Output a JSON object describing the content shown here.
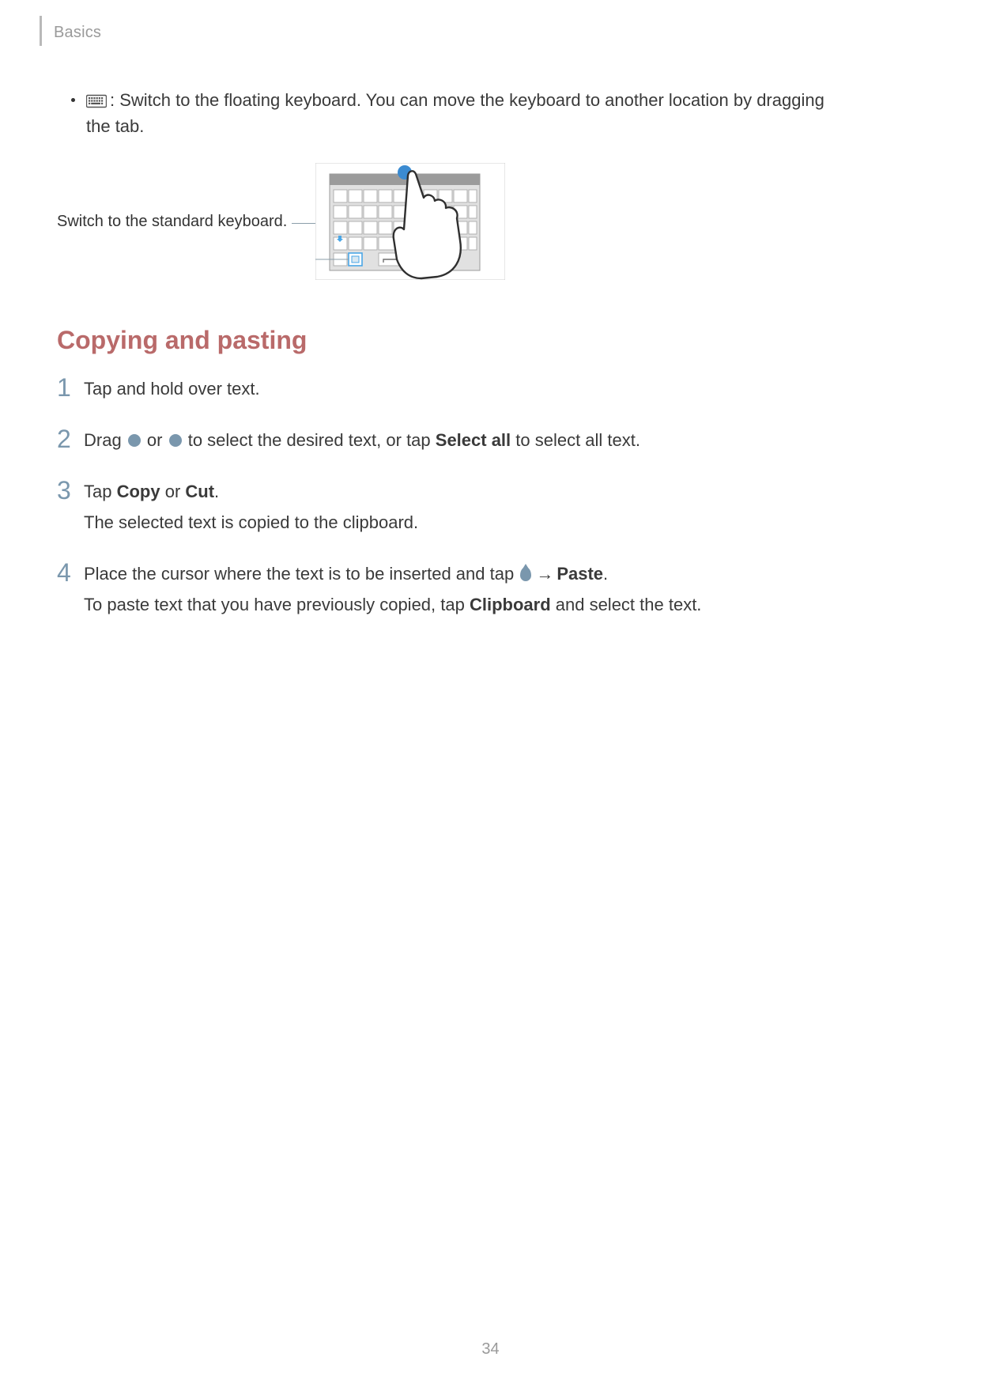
{
  "header": {
    "section": "Basics"
  },
  "bullet": {
    "text_after_icon": ": Switch to the floating keyboard. You can move the keyboard to another location by dragging the tab."
  },
  "figure": {
    "label": "Switch to the standard keyboard."
  },
  "heading": "Copying and pasting",
  "steps": {
    "s1": {
      "num": "1",
      "text": "Tap and hold over text."
    },
    "s2": {
      "num": "2",
      "pre": "Drag ",
      "mid": " or ",
      "post_a": " to select the desired text, or tap ",
      "bold_select_all": "Select all",
      "post_b": " to select all text."
    },
    "s3": {
      "num": "3",
      "pre": "Tap ",
      "bold_copy": "Copy",
      "or": " or ",
      "bold_cut": "Cut",
      "period": ".",
      "line2": "The selected text is copied to the clipboard."
    },
    "s4": {
      "num": "4",
      "pre": "Place the cursor where the text is to be inserted and tap ",
      "arrow": "→",
      "bold_paste": "Paste",
      "period": ".",
      "line2_a": "To paste text that you have previously copied, tap ",
      "bold_clipboard": "Clipboard",
      "line2_b": " and select the text."
    }
  },
  "page_number": "34"
}
